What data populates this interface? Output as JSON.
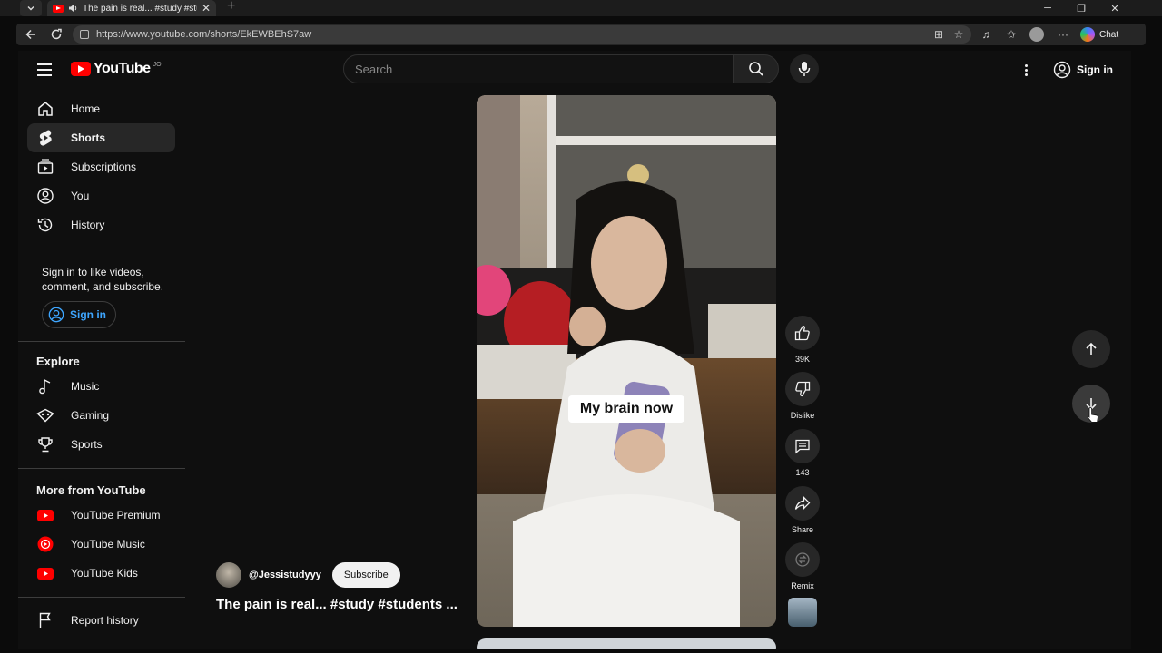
{
  "browser": {
    "tab_title": "The pain is real... #study #stu",
    "url": "https://www.youtube.com/shorts/EkEWBEhS7aw",
    "copilot_label": "Chat"
  },
  "masthead": {
    "logo_text": "YouTube",
    "country_code": "JO",
    "search_placeholder": "Search",
    "signin_label": "Sign in"
  },
  "sidebar": {
    "primary": [
      {
        "label": "Home",
        "icon": "home-icon"
      },
      {
        "label": "Shorts",
        "icon": "shorts-icon",
        "active": true
      },
      {
        "label": "Subscriptions",
        "icon": "subscriptions-icon"
      },
      {
        "label": "You",
        "icon": "you-icon"
      },
      {
        "label": "History",
        "icon": "history-icon"
      }
    ],
    "signin_note": "Sign in to like videos, comment, and subscribe.",
    "signin_button": "Sign in",
    "explore_title": "Explore",
    "explore": [
      {
        "label": "Music",
        "icon": "music-icon"
      },
      {
        "label": "Gaming",
        "icon": "gaming-icon"
      },
      {
        "label": "Sports",
        "icon": "sports-icon"
      }
    ],
    "more_title": "More from YouTube",
    "more": [
      {
        "label": "YouTube Premium",
        "icon": "youtube-premium-icon"
      },
      {
        "label": "YouTube Music",
        "icon": "youtube-music-icon"
      },
      {
        "label": "YouTube Kids",
        "icon": "youtube-kids-icon"
      }
    ],
    "report_history": "Report history"
  },
  "short": {
    "caption": "My brain now",
    "channel_handle": "@Jessistudyyy",
    "subscribe_label": "Subscribe",
    "title": "The pain is real... #study #students ...",
    "actions": {
      "likes": "39K",
      "dislike": "Dislike",
      "comments": "143",
      "share": "Share",
      "remix": "Remix"
    }
  },
  "colors": {
    "brand_red": "#ff0000",
    "link_blue": "#3ea6ff",
    "background": "#0f0f0f"
  }
}
